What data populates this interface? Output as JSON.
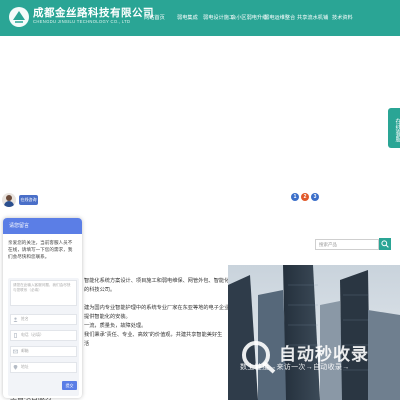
{
  "header": {
    "company_name": "成都金丝路科技有限公司",
    "company_name_en": "CHENGDU JINSILU TECHNOLOGY CO., LTD",
    "nav": [
      "网站首页",
      "弱电集成",
      "弱电设计施工",
      "会小区弱电升级",
      "弱电运维整合",
      "共享流水机铺",
      "技术资料"
    ]
  },
  "float_tab": {
    "label": "在线客服"
  },
  "chat": {
    "avatar_tip": "在线咨询",
    "header_title": "请您留言",
    "greeting": "亲爱您的关注，当前客服人员不在线，请填写一下您的需求，我们会尽快和您联系。",
    "message_placeholder": "请您在此输入客服问题，我们会尽快与您联系（必填）",
    "fields": [
      {
        "icon": "user-icon",
        "placeholder": "姓名"
      },
      {
        "icon": "phone-icon",
        "placeholder": "电话（必填）"
      },
      {
        "icon": "email-icon",
        "placeholder": "邮箱"
      },
      {
        "icon": "location-icon",
        "placeholder": "地址"
      }
    ],
    "submit_label": "提交"
  },
  "carousel": {
    "dots": [
      "1",
      "2",
      "3"
    ]
  },
  "search": {
    "placeholder": "搜索产品"
  },
  "about": {
    "lines": [
      "智能化系统方案设计、项目施工和弱电维保、网管外包、智能化",
      "的科技公司。",
      "建为国内专业智能护理中的系统专业厂家在东亚等地的电子企业的综合",
      "提供智能化的安装。",
      "一流，质量负，故障处理。",
      "我们秉承“责任、专业、高效”的价值观，共建共享智能美好生",
      "活"
    ],
    "footer_heading": "主营项目服务"
  },
  "watermark": {
    "brand": "自动秒收录",
    "slogan": "数上链接→来访一次→自动收录→"
  },
  "colors": {
    "brand": "#2aa595",
    "chat_accent": "#5b7ee6",
    "dot1": "#3b6fc9",
    "dot2": "#e05a2b",
    "dot3": "#3b6fc9"
  }
}
